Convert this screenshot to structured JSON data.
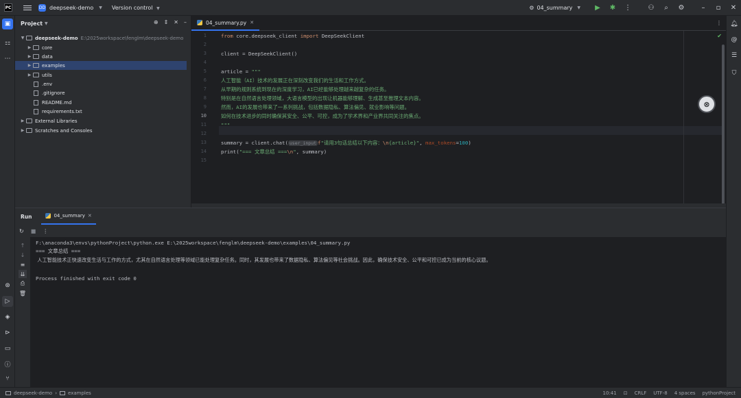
{
  "titlebar": {
    "project_badge": "DD",
    "project_name": "deepseek-demo",
    "vcs_label": "Version control",
    "run_config": "04_summary"
  },
  "colors": {
    "accent": "#3574f0",
    "background": "#1e1f22",
    "panel": "#2b2d30",
    "keyword": "#cf8e6d",
    "string": "#6aab73",
    "number": "#2aacb8",
    "selection": "#2e436e"
  },
  "project_panel": {
    "title": "Project",
    "root_name": "deepseek-demo",
    "root_path": "E:\\2025workspace\\fenglm\\deepseek-demo",
    "items": [
      {
        "label": "core",
        "kind": "folder"
      },
      {
        "label": "data",
        "kind": "folder"
      },
      {
        "label": "examples",
        "kind": "folder",
        "selected": true
      },
      {
        "label": "utils",
        "kind": "folder"
      },
      {
        "label": ".env",
        "kind": "file"
      },
      {
        "label": ".gitignore",
        "kind": "file"
      },
      {
        "label": "README.md",
        "kind": "file"
      },
      {
        "label": "requirements.txt",
        "kind": "file"
      }
    ],
    "external_libraries": "External Libraries",
    "scratches": "Scratches and Consoles"
  },
  "editor": {
    "tab_label": "04_summary.py",
    "current_line": "10",
    "line_numbers": [
      "1",
      "2",
      "3",
      "4",
      "5",
      "6",
      "7",
      "8",
      "9",
      "10",
      "11",
      "12",
      "13",
      "14",
      "15"
    ],
    "code": {
      "l1_kw1": "from",
      "l1_mod": " core.deepseek_client ",
      "l1_kw2": "import",
      "l1_name": " DeepSeekClient",
      "l3": "client = DeepSeekClient()",
      "l5_a": "article = ",
      "l5_b": "\"\"\"",
      "l6": "人工智能（AI）技术的发展正在深刻改变我们的生活和工作方式。",
      "l7": "从早期的规则系统到现在的深度学习，AI已经能够处理越来越复杂的任务。",
      "l8": "特别是在自然语言处理领域，大语言模型的出现让机器能够理解、生成甚至推理文本内容。",
      "l9": "然而，AI的发展也带来了一系列挑战，包括数据隐私、算法偏见、就业影响等问题。",
      "l10": "如何在技术进步的同时确保其安全、公平、可控，成为了学术界和产业界共同关注的焦点。",
      "l11": "\"\"\"",
      "l13_a": "summary = client.chat(",
      "l13_hint": "user_input",
      "l13_f": "f",
      "l13_s1": "\"请用3句话总结以下内容：",
      "l13_esc": "\\n",
      "l13_s2": "{article}\"",
      "l13_c": ", ",
      "l13_p": "max_tokens",
      "l13_eq": "=",
      "l13_n": "100",
      "l13_end": ")",
      "l14_a": "print(",
      "l14_s1": "\"=== 文章总结 ===",
      "l14_esc": "\\n",
      "l14_s2": "\"",
      "l14_b": ", summary)"
    }
  },
  "run_panel": {
    "title": "Run",
    "tab_label": "04_summary",
    "output": [
      "F:\\anaconda3\\envs\\pythonProject\\python.exe E:\\2025workspace\\fenglm\\deepseek-demo\\examples\\04_summary.py",
      "=== 文章总结 ===",
      " 人工智能技术正快速改变生活与工作的方式，尤其在自然语言处理等领域已能处理复杂任务。同时，其发展也带来了数据隐私、算法偏见等社会挑战。因此，确保技术安全、公平和可控已成为当前的核心议题。",
      "",
      "Process finished with exit code 0"
    ]
  },
  "statusbar": {
    "crumb_project": "deepseek-demo",
    "crumb_folder": "examples",
    "position": "10:41",
    "line_sep": "CRLF",
    "encoding": "UTF-8",
    "indent": "4 spaces",
    "interpreter": "pythonProject"
  }
}
